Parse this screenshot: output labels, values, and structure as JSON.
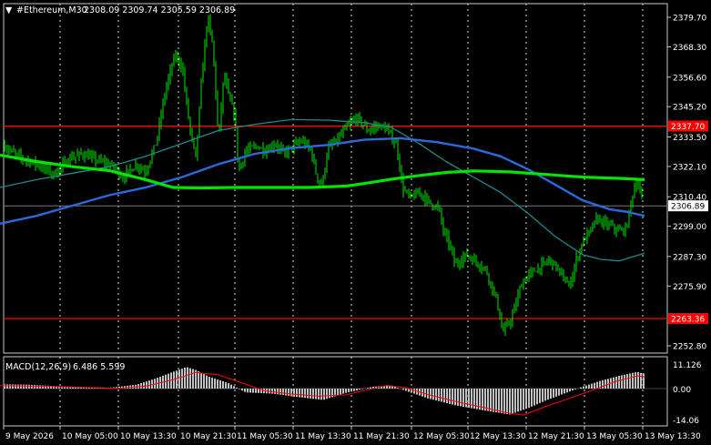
{
  "header": {
    "symbol_label": "#Ethereum,M30",
    "ohlc_label": "2308.09 2309.74 2305.59 2306.89"
  },
  "macd": {
    "label": "MACD(12,26,9)",
    "values_label": "6.486 5.599",
    "ticks": [
      "11.126",
      "0.00",
      "-14.06"
    ]
  },
  "colors": {
    "background": "#000000",
    "candles": "#00e600",
    "fast_ma": "#00e600",
    "mid_ma": "#2a6bdc",
    "slow_ma": "#1f8a8a",
    "level": "#ff0000",
    "macd_hist": "#c0c0c0",
    "macd_signal": "#ff0000",
    "grid": "#ffffff"
  },
  "chart_data": {
    "type": "candlestick",
    "instrument": "#Ethereum",
    "timeframe": "M30",
    "ylim": [
      2250,
      2385
    ],
    "y_ticks": [
      2379.7,
      2368.3,
      2356.6,
      2345.2,
      2333.5,
      2322.1,
      2310.4,
      2299.0,
      2287.3,
      2275.9,
      2252.8
    ],
    "x_ticks": [
      "9 May 2026",
      "10 May 05:00",
      "10 May 13:30",
      "10 May 21:30",
      "11 May 05:30",
      "11 May 13:30",
      "11 May 21:30",
      "12 May 05:30",
      "12 May 13:30",
      "12 May 21:30",
      "13 May 05:30",
      "13 May 13:30"
    ],
    "current_price": "2306.89",
    "levels": [
      {
        "label": "2337.70",
        "value": 2337.7
      },
      {
        "label": "2263.36",
        "value": 2263.36
      }
    ],
    "close_path": [
      [
        0,
        2331
      ],
      [
        20,
        2326
      ],
      [
        40,
        2323
      ],
      [
        60,
        2319
      ],
      [
        75,
        2325
      ],
      [
        90,
        2327
      ],
      [
        110,
        2324
      ],
      [
        125,
        2322
      ],
      [
        135,
        2318
      ],
      [
        150,
        2323
      ],
      [
        160,
        2320
      ],
      [
        172,
        2332
      ],
      [
        182,
        2352
      ],
      [
        192,
        2365
      ],
      [
        200,
        2361
      ],
      [
        208,
        2338
      ],
      [
        215,
        2325
      ],
      [
        222,
        2358
      ],
      [
        228,
        2380
      ],
      [
        234,
        2368
      ],
      [
        240,
        2332
      ],
      [
        246,
        2358
      ],
      [
        252,
        2348
      ],
      [
        258,
        2342
      ],
      [
        262,
        2320
      ],
      [
        270,
        2328
      ],
      [
        282,
        2330
      ],
      [
        292,
        2328
      ],
      [
        302,
        2331
      ],
      [
        312,
        2327
      ],
      [
        322,
        2330
      ],
      [
        332,
        2332
      ],
      [
        342,
        2328
      ],
      [
        348,
        2318
      ],
      [
        354,
        2315
      ],
      [
        360,
        2329
      ],
      [
        370,
        2332
      ],
      [
        380,
        2337
      ],
      [
        392,
        2341
      ],
      [
        404,
        2336
      ],
      [
        416,
        2338
      ],
      [
        426,
        2336
      ],
      [
        436,
        2330
      ],
      [
        442,
        2314
      ],
      [
        450,
        2310
      ],
      [
        462,
        2312
      ],
      [
        472,
        2308
      ],
      [
        482,
        2306
      ],
      [
        488,
        2296
      ],
      [
        494,
        2292
      ],
      [
        500,
        2284
      ],
      [
        512,
        2288
      ],
      [
        524,
        2285
      ],
      [
        534,
        2282
      ],
      [
        540,
        2276
      ],
      [
        546,
        2270
      ],
      [
        552,
        2258
      ],
      [
        560,
        2262
      ],
      [
        566,
        2268
      ],
      [
        572,
        2276
      ],
      [
        580,
        2280
      ],
      [
        592,
        2283
      ],
      [
        604,
        2286
      ],
      [
        612,
        2283
      ],
      [
        620,
        2278
      ],
      [
        626,
        2276
      ],
      [
        632,
        2285
      ],
      [
        640,
        2293
      ],
      [
        648,
        2297
      ],
      [
        656,
        2302
      ],
      [
        664,
        2300
      ],
      [
        672,
        2299
      ],
      [
        680,
        2297
      ],
      [
        688,
        2298
      ],
      [
        694,
        2310
      ],
      [
        700,
        2317
      ],
      [
        706,
        2306.89
      ]
    ],
    "fast_ma": [
      [
        0,
        2326.5
      ],
      [
        40,
        2324
      ],
      [
        80,
        2322
      ],
      [
        120,
        2320.5
      ],
      [
        160,
        2317
      ],
      [
        190,
        2314
      ],
      [
        220,
        2313.8
      ],
      [
        260,
        2314
      ],
      [
        300,
        2314
      ],
      [
        340,
        2314
      ],
      [
        380,
        2314.5
      ],
      [
        400,
        2315.5
      ],
      [
        430,
        2317.2
      ],
      [
        460,
        2318.6
      ],
      [
        490,
        2319.8
      ],
      [
        520,
        2320.4
      ],
      [
        560,
        2320
      ],
      [
        600,
        2319
      ],
      [
        640,
        2318
      ],
      [
        680,
        2317.5
      ],
      [
        708,
        2317
      ]
    ],
    "mid_ma": [
      [
        0,
        2300
      ],
      [
        40,
        2303
      ],
      [
        80,
        2307
      ],
      [
        120,
        2311
      ],
      [
        160,
        2314
      ],
      [
        200,
        2318
      ],
      [
        240,
        2323
      ],
      [
        280,
        2327
      ],
      [
        320,
        2329.2
      ],
      [
        360,
        2330.4
      ],
      [
        400,
        2332.4
      ],
      [
        440,
        2333
      ],
      [
        480,
        2331.5
      ],
      [
        520,
        2329
      ],
      [
        550,
        2326
      ],
      [
        580,
        2321
      ],
      [
        610,
        2315
      ],
      [
        640,
        2309
      ],
      [
        670,
        2305.5
      ],
      [
        690,
        2304.5
      ],
      [
        708,
        2303
      ]
    ],
    "slow_ma": [
      [
        0,
        2314
      ],
      [
        40,
        2317
      ],
      [
        80,
        2319.5
      ],
      [
        120,
        2322
      ],
      [
        160,
        2326
      ],
      [
        200,
        2331
      ],
      [
        240,
        2336
      ],
      [
        280,
        2338.4
      ],
      [
        320,
        2340.2
      ],
      [
        360,
        2340
      ],
      [
        400,
        2339
      ],
      [
        430,
        2337.2
      ],
      [
        460,
        2331
      ],
      [
        490,
        2324
      ],
      [
        520,
        2318
      ],
      [
        550,
        2312
      ],
      [
        580,
        2304
      ],
      [
        610,
        2295
      ],
      [
        640,
        2288
      ],
      [
        660,
        2286.2
      ],
      [
        680,
        2285.6
      ],
      [
        708,
        2288.6
      ]
    ],
    "macd_hist": [
      [
        0,
        2.2
      ],
      [
        30,
        2
      ],
      [
        60,
        1.3
      ],
      [
        90,
        0.8
      ],
      [
        120,
        0.4
      ],
      [
        150,
        2
      ],
      [
        170,
        5
      ],
      [
        190,
        8.5
      ],
      [
        205,
        11
      ],
      [
        215,
        9.5
      ],
      [
        230,
        6
      ],
      [
        250,
        3
      ],
      [
        270,
        -2
      ],
      [
        300,
        -2.6
      ],
      [
        330,
        -4.5
      ],
      [
        355,
        -5.8
      ],
      [
        380,
        -2.2
      ],
      [
        410,
        1
      ],
      [
        430,
        1.6
      ],
      [
        445,
        -1
      ],
      [
        470,
        -5
      ],
      [
        500,
        -8.5
      ],
      [
        530,
        -11
      ],
      [
        560,
        -13.2
      ],
      [
        580,
        -10
      ],
      [
        600,
        -6
      ],
      [
        620,
        -2.5
      ],
      [
        640,
        1
      ],
      [
        660,
        4
      ],
      [
        680,
        6.5
      ],
      [
        700,
        8.5
      ],
      [
        708,
        7.5
      ]
    ],
    "macd_signal": [
      [
        0,
        1.5
      ],
      [
        40,
        1.2
      ],
      [
        90,
        0.6
      ],
      [
        130,
        0.2
      ],
      [
        160,
        1.2
      ],
      [
        190,
        4.5
      ],
      [
        215,
        8.2
      ],
      [
        240,
        7
      ],
      [
        265,
        3
      ],
      [
        290,
        -1
      ],
      [
        320,
        -2.8
      ],
      [
        350,
        -3.8
      ],
      [
        380,
        -3.2
      ],
      [
        400,
        -1
      ],
      [
        425,
        1.6
      ],
      [
        445,
        0.5
      ],
      [
        470,
        -3
      ],
      [
        500,
        -6.5
      ],
      [
        530,
        -9.5
      ],
      [
        560,
        -12.6
      ],
      [
        575,
        -13.5
      ],
      [
        600,
        -9
      ],
      [
        625,
        -5
      ],
      [
        650,
        -1
      ],
      [
        675,
        3.5
      ],
      [
        700,
        6.5
      ],
      [
        708,
        6
      ]
    ]
  }
}
